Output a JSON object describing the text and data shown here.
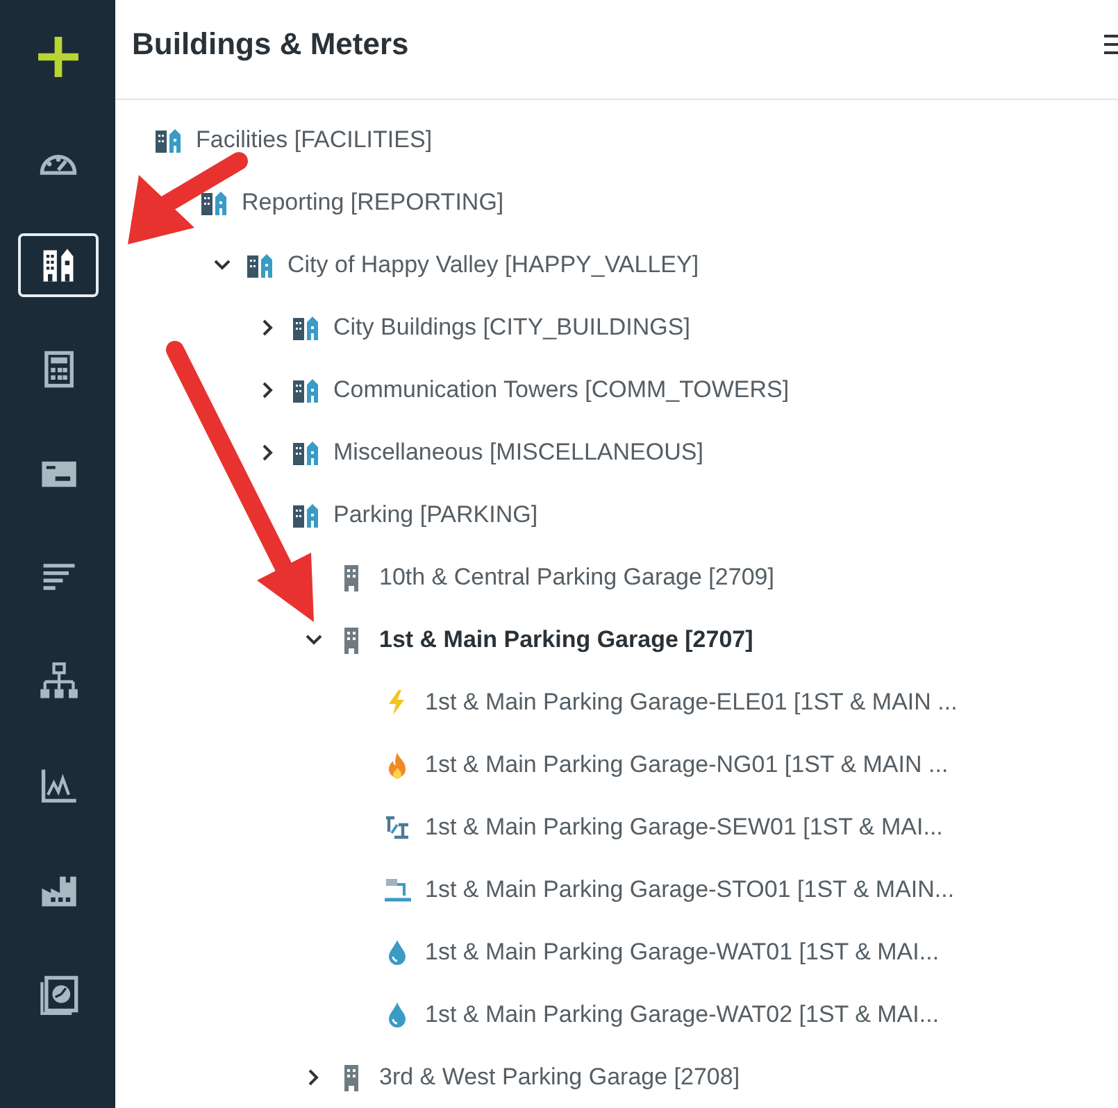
{
  "sidebar": {
    "items": [
      {
        "selected": false
      },
      {
        "selected": false
      },
      {
        "selected": true
      },
      {
        "selected": false
      },
      {
        "selected": false
      },
      {
        "selected": false
      },
      {
        "selected": false
      },
      {
        "selected": false
      },
      {
        "selected": false
      },
      {
        "selected": false
      }
    ]
  },
  "panel": {
    "title": "Buildings & Meters"
  },
  "tree": [
    {
      "label": "Facilities [FACILITIES]",
      "kind": "group",
      "selected": false,
      "children": [
        {
          "label": "Reporting [REPORTING]",
          "kind": "group",
          "selected": false,
          "children": [
            {
              "label": "City of Happy Valley [HAPPY_VALLEY]",
              "kind": "group",
              "expanded": true,
              "selected": false,
              "children": [
                {
                  "label": "City Buildings [CITY_BUILDINGS]",
                  "kind": "group",
                  "expanded": false,
                  "selected": false
                },
                {
                  "label": "Communication Towers [COMM_TOWERS]",
                  "kind": "group",
                  "expanded": false,
                  "selected": false
                },
                {
                  "label": "Miscellaneous [MISCELLANEOUS]",
                  "kind": "group",
                  "expanded": false,
                  "selected": false
                },
                {
                  "label": "Parking [PARKING]",
                  "kind": "group",
                  "selected": false,
                  "children": [
                    {
                      "label": "10th & Central Parking Garage [2709]",
                      "kind": "building",
                      "selected": false
                    },
                    {
                      "label": "1st & Main Parking Garage [2707]",
                      "kind": "building",
                      "expanded": true,
                      "selected": true,
                      "children": [
                        {
                          "label": "1st & Main Parking Garage-ELE01 [1ST & MAIN ...",
                          "kind": "electric",
                          "selected": false
                        },
                        {
                          "label": "1st & Main Parking Garage-NG01 [1ST & MAIN ...",
                          "kind": "gas",
                          "selected": false
                        },
                        {
                          "label": "1st & Main Parking Garage-SEW01 [1ST & MAI...",
                          "kind": "sewer",
                          "selected": false
                        },
                        {
                          "label": "1st & Main Parking Garage-STO01 [1ST & MAIN...",
                          "kind": "storm",
                          "selected": false
                        },
                        {
                          "label": "1st & Main Parking Garage-WAT01 [1ST & MAI...",
                          "kind": "water",
                          "selected": false
                        },
                        {
                          "label": "1st & Main Parking Garage-WAT02 [1ST & MAI...",
                          "kind": "water",
                          "selected": false
                        }
                      ]
                    },
                    {
                      "label": "3rd & West Parking Garage [2708]",
                      "kind": "building",
                      "expanded": false,
                      "selected": false
                    }
                  ]
                }
              ]
            }
          ]
        }
      ]
    }
  ]
}
